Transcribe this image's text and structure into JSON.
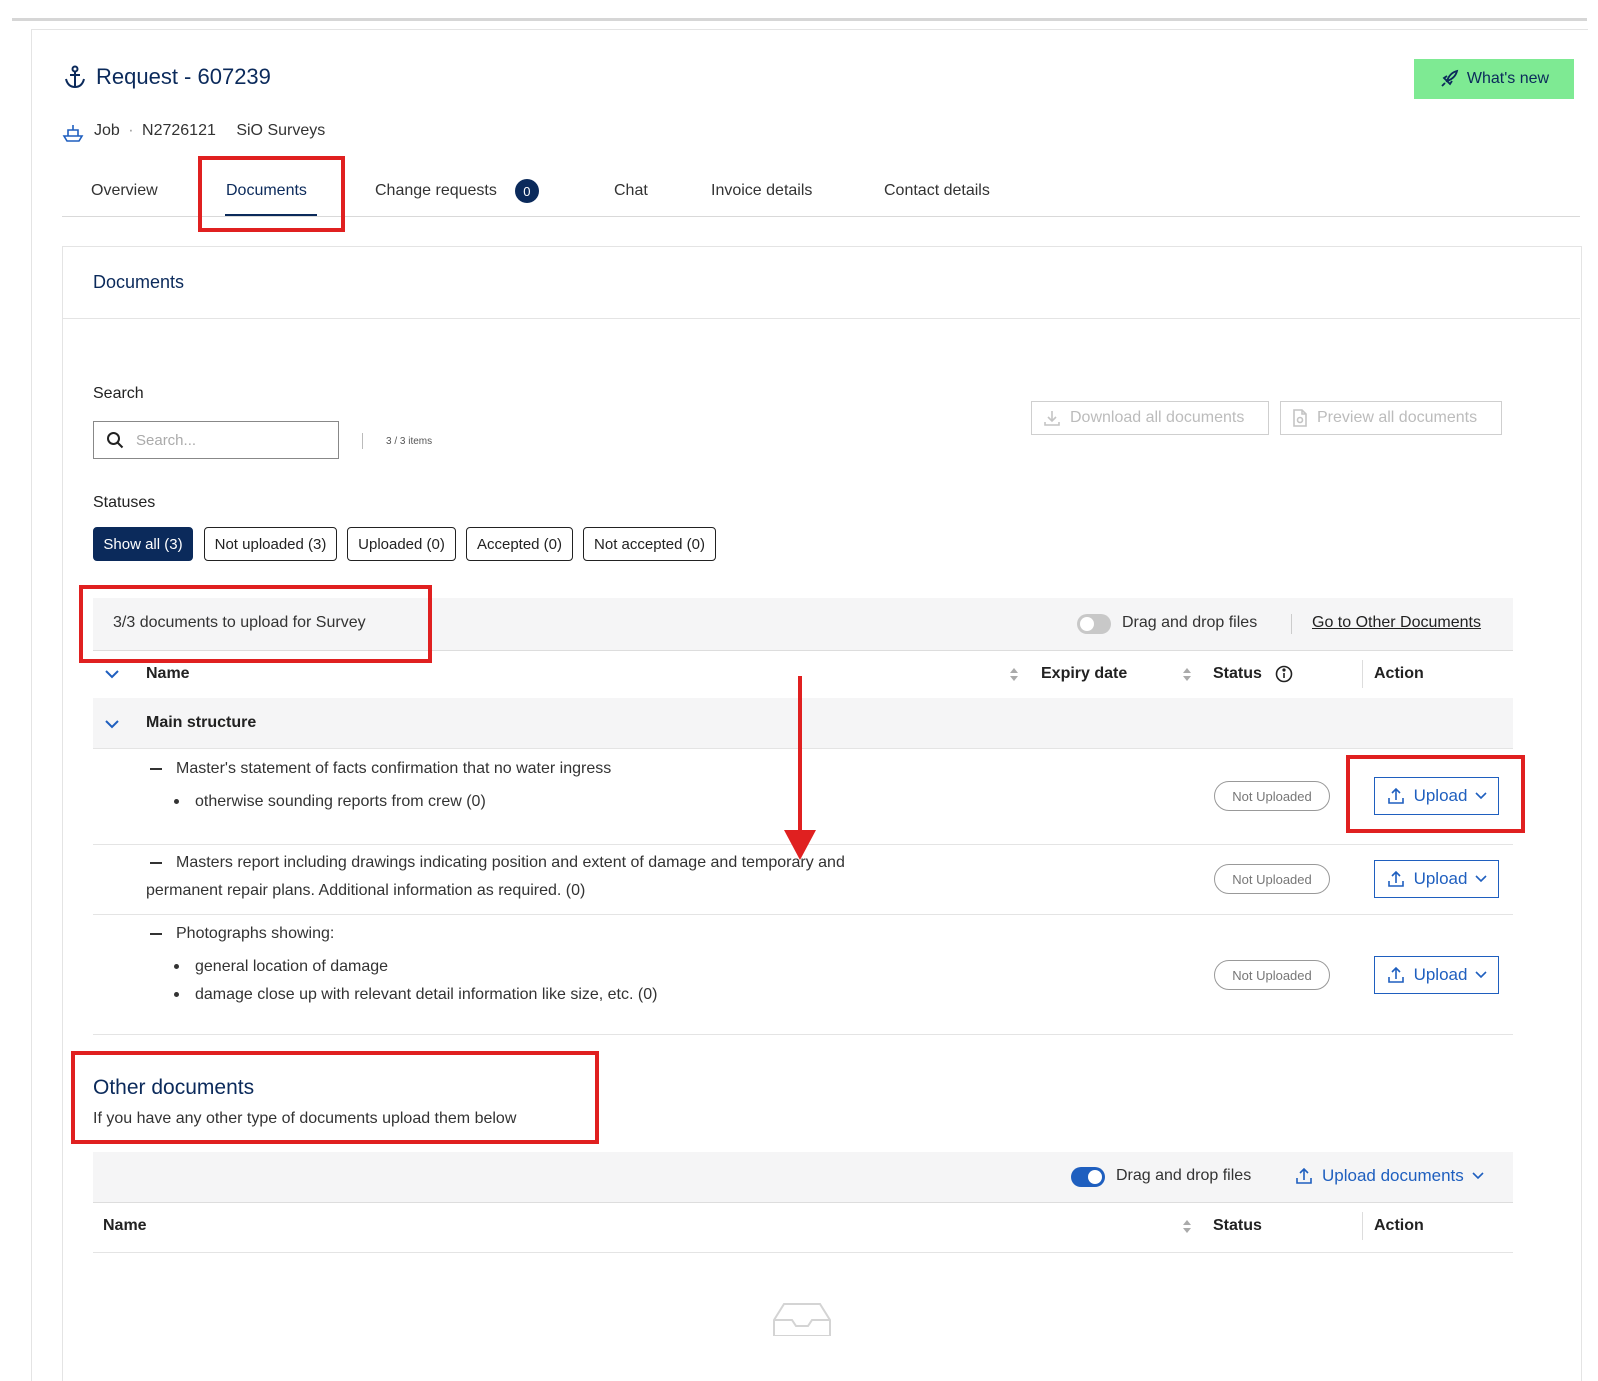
{
  "header": {
    "title": "Request - 607239",
    "job_label": "Job",
    "job_number": "N2726121",
    "company": "SiO Surveys",
    "whats_new": "What's new"
  },
  "tabs": [
    {
      "label": "Overview"
    },
    {
      "label": "Documents",
      "active": true
    },
    {
      "label": "Change requests",
      "badge": "0"
    },
    {
      "label": "Chat"
    },
    {
      "label": "Invoice details"
    },
    {
      "label": "Contact details"
    }
  ],
  "documents": {
    "heading": "Documents",
    "search_label": "Search",
    "search_placeholder": "Search...",
    "items_count": "3 / 3 items",
    "download_all": "Download all documents",
    "preview_all": "Preview all documents",
    "statuses_label": "Statuses",
    "chips": [
      "Show all (3)",
      "Not uploaded (3)",
      "Uploaded (0)",
      "Accepted (0)",
      "Not accepted (0)"
    ],
    "summary": "3/3 documents to upload for Survey",
    "drag_drop": "Drag and drop files",
    "go_other": "Go to Other Documents",
    "columns": {
      "name": "Name",
      "expiry": "Expiry date",
      "status": "Status",
      "action": "Action"
    },
    "group": "Main structure",
    "rows": [
      {
        "title": "Master's statement of facts confirmation that no water ingress",
        "bullets": [
          "otherwise sounding reports from crew (0)"
        ],
        "status": "Not Uploaded",
        "action": "Upload"
      },
      {
        "title": "Masters report including drawings indicating position and extent of damage and temporary and",
        "continuation": "permanent repair plans. Additional information as required. (0)",
        "status": "Not Uploaded",
        "action": "Upload"
      },
      {
        "title": "Photographs showing:",
        "bullets": [
          "general location of damage",
          "damage close up with relevant detail information like size, etc. (0)"
        ],
        "status": "Not Uploaded",
        "action": "Upload"
      }
    ]
  },
  "other": {
    "heading": "Other documents",
    "description": "If you have any other type of documents upload them below",
    "drag_drop": "Drag and drop files",
    "upload_documents": "Upload documents",
    "columns": {
      "name": "Name",
      "status": "Status",
      "action": "Action"
    }
  },
  "colors": {
    "navy": "#0b2a5b",
    "accent_blue": "#1f5fbf",
    "whats_new_green": "#7eea93",
    "annotation_red": "#e02020"
  }
}
